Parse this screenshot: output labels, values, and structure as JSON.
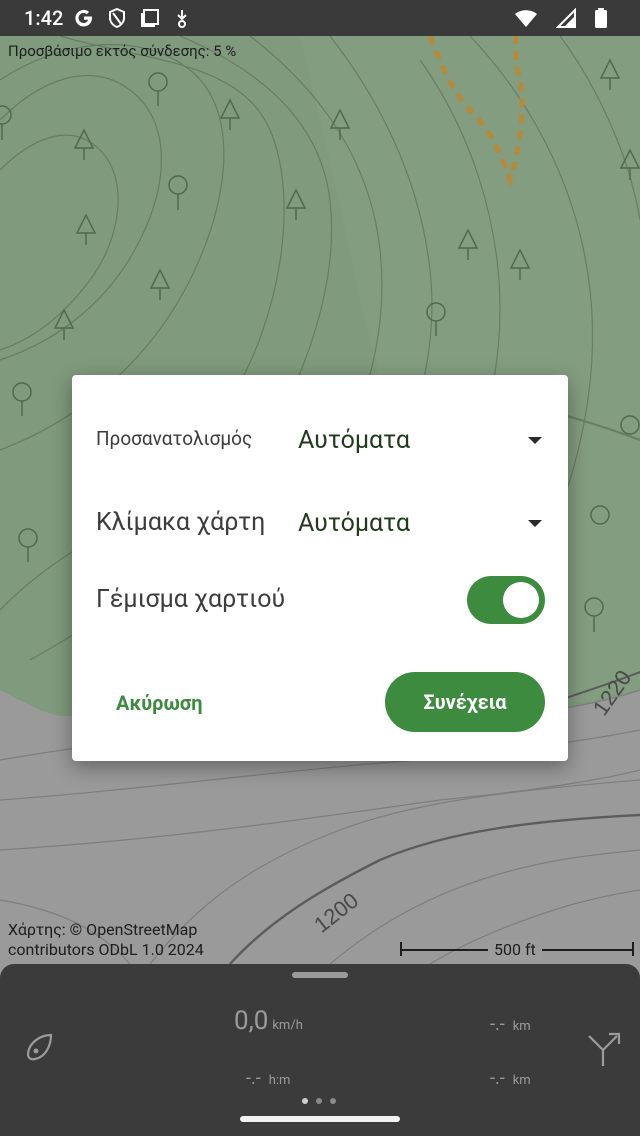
{
  "statusbar": {
    "time": "1:42",
    "left_icons": [
      "google-g-icon",
      "shield-icon",
      "screen-icon",
      "download-icon"
    ],
    "right_icons": [
      "wifi-icon",
      "signal-icon",
      "battery-icon"
    ]
  },
  "map": {
    "offline_text": "Προσβάσιμο εκτός σύνδεσης: 5 %",
    "attribution_line1": "Χάρτης: © OpenStreetMap",
    "attribution_line2": "contributors ODbL 1.0 2024",
    "scale_label": "500 ft",
    "contour_labels": [
      "1200",
      "1220"
    ]
  },
  "dialog": {
    "orientation_label": "Προσανατολισμός",
    "orientation_value": "Αυτόματα",
    "scale_label": "Κλίμακα χάρτη",
    "scale_value": "Αυτόματα",
    "fill_label": "Γέμισμα χαρτιού",
    "fill_on": true,
    "cancel_label": "Ακύρωση",
    "continue_label": "Συνέχεια"
  },
  "panel": {
    "speed_value": "0,0",
    "speed_unit": "km/h",
    "distance1_value": "-.-",
    "distance1_unit": "km",
    "time_value": "-.-",
    "time_unit": "h:m",
    "distance2_value": "-.-",
    "distance2_unit": "km",
    "pages": 3,
    "active_page": 0
  },
  "colors": {
    "accent": "#3c8b3e",
    "forest": "#7f9a7c",
    "panel": "#3b3b3b"
  }
}
